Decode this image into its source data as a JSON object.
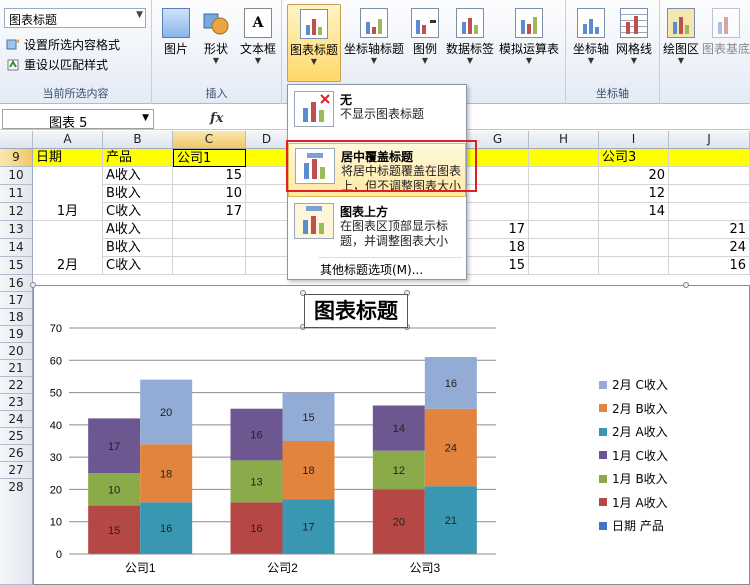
{
  "ribbon": {
    "selection_box": "图表标题",
    "format_selection": "设置所选内容格式",
    "reset_style": "重设以匹配样式",
    "group_current_selection": "当前所选内容",
    "btn_picture": "图片",
    "btn_shape": "形状",
    "btn_textbox": "文本框",
    "group_insert": "插入",
    "btn_chart_title": "图表标题",
    "btn_axis_title": "坐标轴标题",
    "btn_legend": "图例",
    "btn_data_labels": "数据标签",
    "btn_data_table": "模拟运算表",
    "btn_axes": "坐标轴",
    "btn_gridlines": "网格线",
    "group_axes": "坐标轴",
    "btn_plot_area": "绘图区",
    "btn_chart_wall": "图表基底",
    "textbox_glyph": "A"
  },
  "formula_bar": {
    "name_box": "图表 5",
    "fx": "fx"
  },
  "columns": [
    "A",
    "B",
    "C",
    "D",
    "E",
    "F",
    "G",
    "H",
    "I",
    "J"
  ],
  "rows": [
    "9",
    "10",
    "11",
    "12",
    "13",
    "14",
    "15",
    "16",
    "17",
    "18",
    "19",
    "20",
    "21",
    "22",
    "23",
    "24",
    "25",
    "26",
    "27",
    "28"
  ],
  "cells": {
    "a9": "日期",
    "b9": "产品",
    "c9": "公司1",
    "i9": "公司3",
    "b10": "A收入",
    "c10": "15",
    "i10": "20",
    "b11": "B收入",
    "c11": "10",
    "i11": "12",
    "a12": "1月",
    "b12": "C收入",
    "c12": "17",
    "i12": "14",
    "b13": "A收入",
    "g13": "17",
    "j13": "21",
    "b14": "B收入",
    "g14": "18",
    "j14": "24",
    "a15": "2月",
    "b15": "C收入",
    "g15": "15",
    "j15": "16"
  },
  "dropdown": {
    "none_title": "无",
    "none_desc": "不显示图表标题",
    "overlay_title": "居中覆盖标题",
    "overlay_desc": "将居中标题覆盖在图表上，但不调整图表大小",
    "above_title": "图表上方",
    "above_desc": "在图表区顶部显示标题，并调整图表大小",
    "more": "其他标题选项(M)..."
  },
  "chart_data": {
    "type": "bar",
    "stacked": true,
    "title": "图表标题",
    "categories": [
      "公司1",
      "公司2",
      "公司3"
    ],
    "ylim": [
      0,
      70
    ],
    "yticks": [
      0,
      10,
      20,
      30,
      40,
      50,
      60,
      70
    ],
    "grid": true,
    "legend_position": "right",
    "groups": [
      {
        "category": "公司1",
        "stacks": [
          {
            "month": "1月",
            "values": [
              15,
              10,
              17
            ]
          },
          {
            "month": "2月",
            "values": [
              16,
              18,
              20
            ]
          }
        ]
      },
      {
        "category": "公司2",
        "stacks": [
          {
            "month": "1月",
            "values": [
              16,
              13,
              16
            ]
          },
          {
            "month": "2月",
            "values": [
              17,
              18,
              15
            ]
          }
        ]
      },
      {
        "category": "公司3",
        "stacks": [
          {
            "month": "1月",
            "values": [
              20,
              12,
              14
            ]
          },
          {
            "month": "2月",
            "values": [
              21,
              24,
              16
            ]
          }
        ]
      }
    ],
    "series_colors": {
      "1月 A收入": "#b54845",
      "1月 B收入": "#8bab4b",
      "1月 C收入": "#6d5791",
      "2月 A收入": "#3a97b1",
      "2月 B收入": "#e3843e",
      "2月 C收入": "#93acd5"
    },
    "legend": [
      {
        "name": "2月 C收入",
        "color": "#93acd5"
      },
      {
        "name": "2月 B收入",
        "color": "#e3843e"
      },
      {
        "name": "2月 A收入",
        "color": "#3a97b1"
      },
      {
        "name": "1月 C收入",
        "color": "#6d5791"
      },
      {
        "name": "1月 B收入",
        "color": "#8bab4b"
      },
      {
        "name": "1月 A收入",
        "color": "#b54845"
      },
      {
        "name": "日期 产品",
        "color": "#4472c4"
      }
    ]
  }
}
